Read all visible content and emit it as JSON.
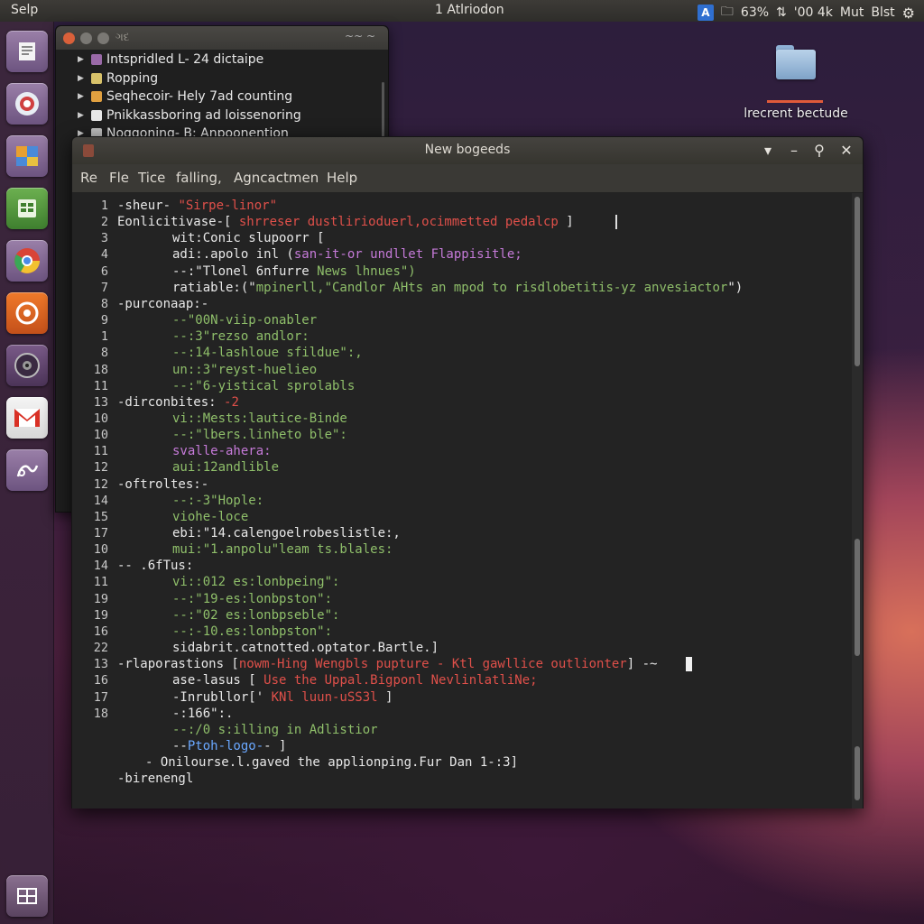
{
  "top_panel": {
    "app_name": "Selp",
    "clock": "1 Atlriodon",
    "keyboard": "A",
    "battery": "63%",
    "network": "'00 4k",
    "volume": "Mut",
    "user": "Blst"
  },
  "launcher": {
    "icons": [
      "files-icon",
      "browser-icon",
      "software-center-icon",
      "spreadsheet-icon",
      "chrome-icon",
      "ubuntu-one-icon",
      "disc-icon",
      "gmail-icon",
      "script-icon",
      "workspace-icon"
    ]
  },
  "desktop": {
    "folder_label": "lrecrent bectude"
  },
  "bg_window": {
    "title": "ગદ",
    "toolbar": "~~ ~",
    "items": [
      {
        "label": "Intspridled L- 24 dictaipe",
        "color": "#9a6aa8"
      },
      {
        "label": "Ropping",
        "color": "#d8c26a"
      },
      {
        "label": "Seqhecoir- Hely 7ad counting",
        "color": "#e0a040"
      },
      {
        "label": "Pnikkassboring ad loissenoring",
        "color": "#e8e8e8"
      },
      {
        "label": "Noggoning- B: Anpoonention",
        "color": "#bfbfbf"
      }
    ]
  },
  "editor": {
    "title": "New bogeeds",
    "controls": {
      "menu": "▾",
      "minimize": "–",
      "search": "⚲",
      "close": "✕"
    },
    "menu": [
      "Re",
      "Fle",
      "Tice",
      "falling,",
      "Agncactmen",
      "Help"
    ],
    "line_numbers": [
      "1",
      "2",
      "3",
      "4",
      "6",
      "7",
      "8",
      "9",
      "1",
      "8",
      "18",
      "11",
      "13",
      "10",
      "10",
      "11",
      "12",
      "12",
      "14",
      "15",
      "17",
      "10",
      "14",
      "11",
      "19",
      "19",
      "16",
      "22",
      "13",
      "16",
      "17",
      "18"
    ],
    "lines": [
      {
        "indent": 0,
        "segs": [
          {
            "t": "-sheur- ",
            "c": "default"
          },
          {
            "t": "\"Sirpe-linor\"",
            "c": "red"
          }
        ]
      },
      {
        "indent": 0,
        "segs": [
          {
            "t": "Eonlicitivase-[ ",
            "c": "default"
          },
          {
            "t": "shrreser dustlirioduerl,ocimmetted pedalcp",
            "c": "red"
          },
          {
            "t": " ]",
            "c": "default"
          }
        ]
      },
      {
        "indent": 1,
        "segs": [
          {
            "t": "wit:Conic slupoorr [",
            "c": "default"
          }
        ]
      },
      {
        "indent": 1,
        "segs": [
          {
            "t": "adi:.apolo inl (",
            "c": "default"
          },
          {
            "t": "san-it-or undllet Flappisitle;",
            "c": "purple"
          }
        ]
      },
      {
        "indent": 1,
        "segs": [
          {
            "t": "--:\"Tlonel 6nfurre ",
            "c": "default"
          },
          {
            "t": "News lhnues\")",
            "c": "green"
          }
        ]
      },
      {
        "indent": 1,
        "segs": [
          {
            "t": "ratiable:(\"",
            "c": "default"
          },
          {
            "t": "mpinerll,\"Candlor AHts an mpod to risdlobetitis-yz anvesiactor",
            "c": "green"
          },
          {
            "t": "\")",
            "c": "default"
          }
        ]
      },
      {
        "indent": 0,
        "segs": [
          {
            "t": "-purconaap:-",
            "c": "default"
          }
        ]
      },
      {
        "indent": 1,
        "segs": [
          {
            "t": "--\"00N-viip-onabler",
            "c": "green"
          }
        ]
      },
      {
        "indent": 1,
        "segs": [
          {
            "t": "--:3\"rezso andlor:",
            "c": "green"
          }
        ]
      },
      {
        "indent": 1,
        "segs": [
          {
            "t": "--:14-lashloue sfildue\":,",
            "c": "green"
          }
        ]
      },
      {
        "indent": 1,
        "segs": [
          {
            "t": "un::3\"reyst-huelieo",
            "c": "green"
          }
        ]
      },
      {
        "indent": 1,
        "segs": [
          {
            "t": "--:\"6-yistical sprolabls",
            "c": "green"
          }
        ]
      },
      {
        "indent": 0,
        "segs": [
          {
            "t": "-dirconbites: ",
            "c": "default"
          },
          {
            "t": "-2",
            "c": "red"
          }
        ]
      },
      {
        "indent": 1,
        "segs": [
          {
            "t": "vi::Mests:lautice-Binde",
            "c": "green"
          }
        ]
      },
      {
        "indent": 1,
        "segs": [
          {
            "t": "--:\"lbers.linheto ble\":",
            "c": "green"
          }
        ]
      },
      {
        "indent": 1,
        "segs": [
          {
            "t": "svalle-ahera:",
            "c": "purple"
          }
        ]
      },
      {
        "indent": 1,
        "segs": [
          {
            "t": "aui:12andlible",
            "c": "green"
          }
        ]
      },
      {
        "indent": 0,
        "segs": [
          {
            "t": "-oftroltes:-",
            "c": "default"
          }
        ]
      },
      {
        "indent": 1,
        "segs": [
          {
            "t": "--:-3\"Hople:",
            "c": "green"
          }
        ]
      },
      {
        "indent": 1,
        "segs": [
          {
            "t": "viohe-loce",
            "c": "green"
          }
        ]
      },
      {
        "indent": 1,
        "segs": [
          {
            "t": "ebi:\"14.calengoelrobeslistle:,",
            "c": "default"
          }
        ]
      },
      {
        "indent": 1,
        "segs": [
          {
            "t": "mui:\"1.anpolu\"leam ts.blales:",
            "c": "green"
          }
        ]
      },
      {
        "indent": 0,
        "segs": [
          {
            "t": "-- .6fTus:",
            "c": "default"
          }
        ]
      },
      {
        "indent": 1,
        "segs": [
          {
            "t": "vi::012 es:lonbpeing\":",
            "c": "green"
          }
        ]
      },
      {
        "indent": 1,
        "segs": [
          {
            "t": "--:\"19-es:lonbpston\":",
            "c": "green"
          }
        ]
      },
      {
        "indent": 1,
        "segs": [
          {
            "t": "--:\"02 es:lonbpseble\":",
            "c": "green"
          }
        ]
      },
      {
        "indent": 1,
        "segs": [
          {
            "t": "--:-10.es:lonbpston\":",
            "c": "green"
          }
        ]
      },
      {
        "indent": 1,
        "segs": [
          {
            "t": "sidabrit.catnotted.optator.Bartle.]",
            "c": "default"
          }
        ]
      },
      {
        "indent": 0,
        "segs": [
          {
            "t": "-rlaporastions [",
            "c": "default"
          },
          {
            "t": "nowm-Hing Wengbls pupture - Ktl gawllice outlionter",
            "c": "red"
          },
          {
            "t": "] -~",
            "c": "default"
          }
        ]
      },
      {
        "indent": 2,
        "segs": [
          {
            "t": "ase-lasus [ ",
            "c": "default"
          },
          {
            "t": "Use the Uppal.Bigponl NevlinlatliNe;",
            "c": "red"
          }
        ]
      },
      {
        "indent": 2,
        "segs": [
          {
            "t": "-Inrubllor[' ",
            "c": "default"
          },
          {
            "t": "KNl luun-uSS3l",
            "c": "red"
          },
          {
            "t": " ]",
            "c": "default"
          }
        ]
      },
      {
        "indent": 2,
        "segs": [
          {
            "t": "-:166\":.",
            "c": "default"
          }
        ]
      },
      {
        "indent": 2,
        "segs": [
          {
            "t": "--:/0 s:illing in Adlistior",
            "c": "green"
          }
        ]
      },
      {
        "indent": 2,
        "segs": [
          {
            "t": "--",
            "c": "default"
          },
          {
            "t": "Ptoh-logo-",
            "c": "blue"
          },
          {
            "t": "- ]",
            "c": "default"
          }
        ]
      },
      {
        "indent": 3,
        "segs": [
          {
            "t": "- Onilourse.l.gaved the applionping.Fur Dan 1-:3]",
            "c": "default"
          }
        ]
      },
      {
        "indent": 0,
        "segs": [
          {
            "t": "-birenengl",
            "c": "default"
          }
        ]
      }
    ]
  },
  "colors": {
    "accent": "#e05a3a",
    "code_red": "#e0504a",
    "code_green": "#8fbf6a",
    "code_purple": "#c57ad8",
    "code_blue": "#6aa8ff"
  }
}
